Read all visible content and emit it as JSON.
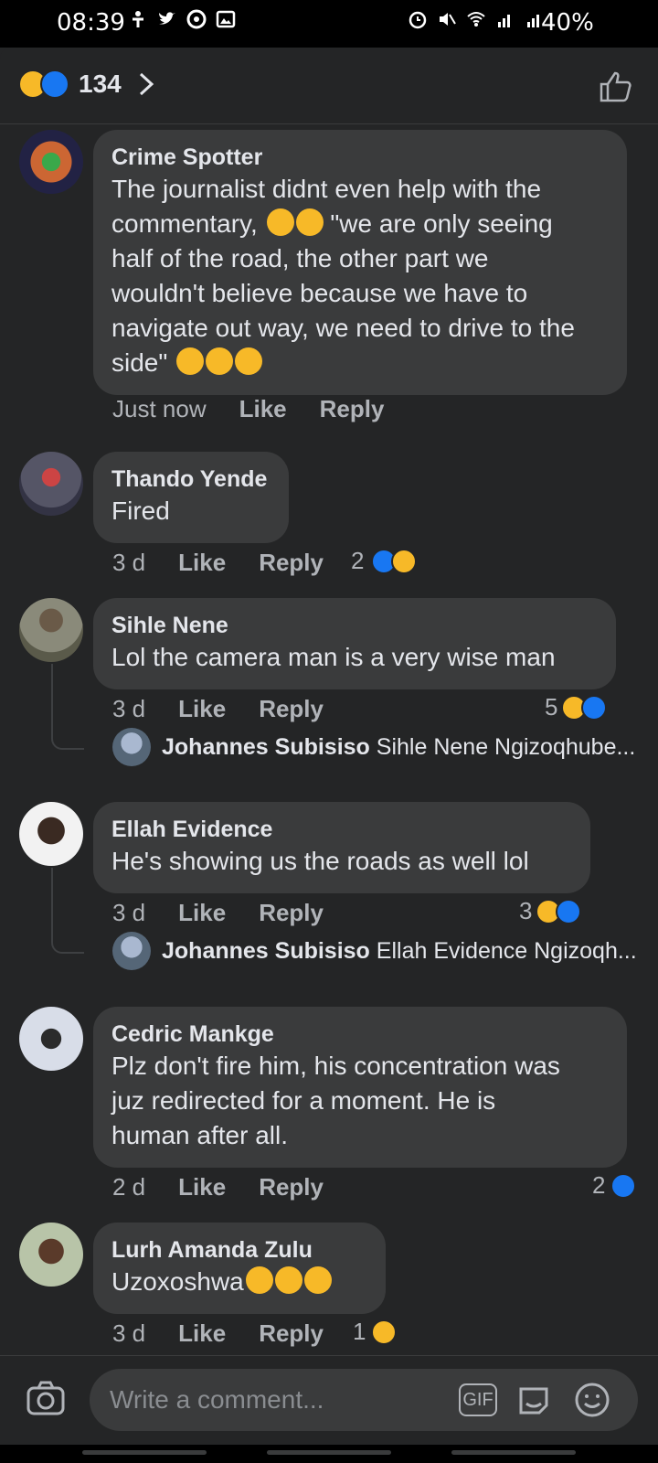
{
  "status_bar": {
    "time": "08:39",
    "battery": "40%"
  },
  "header": {
    "reaction_count": "134",
    "reaction_icons": [
      "haha-icon",
      "like-icon"
    ]
  },
  "comments": [
    {
      "name": "Crime Spotter",
      "text_lines": [
        "The journalist didnt even help with the",
        "commentary,",
        "\"we are only seeing",
        "half of the road, the other part we",
        "wouldn't believe because we have to",
        "navigate out way, we need to drive to the",
        "side\""
      ],
      "time": "Just now",
      "like": "Like",
      "reply": "Reply"
    },
    {
      "name": "Thando Yende",
      "text": "Fired",
      "time": "3 d",
      "like": "Like",
      "reply": "Reply",
      "reaction_count": "2"
    },
    {
      "name": "Sihle Nene",
      "text": "Lol the camera man is a very wise man",
      "time": "3 d",
      "like": "Like",
      "reply": "Reply",
      "reaction_count": "5",
      "reply_preview": {
        "name": "Johannes Subisiso",
        "text": "Sihle Nene Ngizoqhube..."
      }
    },
    {
      "name": "Ellah Evidence",
      "text": "He's showing us the roads as well lol",
      "time": "3 d",
      "like": "Like",
      "reply": "Reply",
      "reaction_count": "3",
      "reply_preview": {
        "name": "Johannes Subisiso",
        "text": "Ellah Evidence Ngizoqh..."
      }
    },
    {
      "name": "Cedric Mankge",
      "text_lines": [
        "Plz don't fire him, his concentration was",
        "juz redirected for a moment. He is",
        "human after all."
      ],
      "time": "2 d",
      "like": "Like",
      "reply": "Reply",
      "reaction_count": "2"
    },
    {
      "name": "Lurh Amanda Zulu",
      "text": "Uzoxoshwa",
      "time": "3 d",
      "like": "Like",
      "reply": "Reply",
      "reaction_count": "1"
    }
  ],
  "composer": {
    "placeholder": "Write a comment...",
    "gif_label": "GIF"
  },
  "colors": {
    "background": "#242526",
    "bubble": "#3a3b3c",
    "like_blue": "#1877f2",
    "haha_yellow": "#f7b928"
  }
}
